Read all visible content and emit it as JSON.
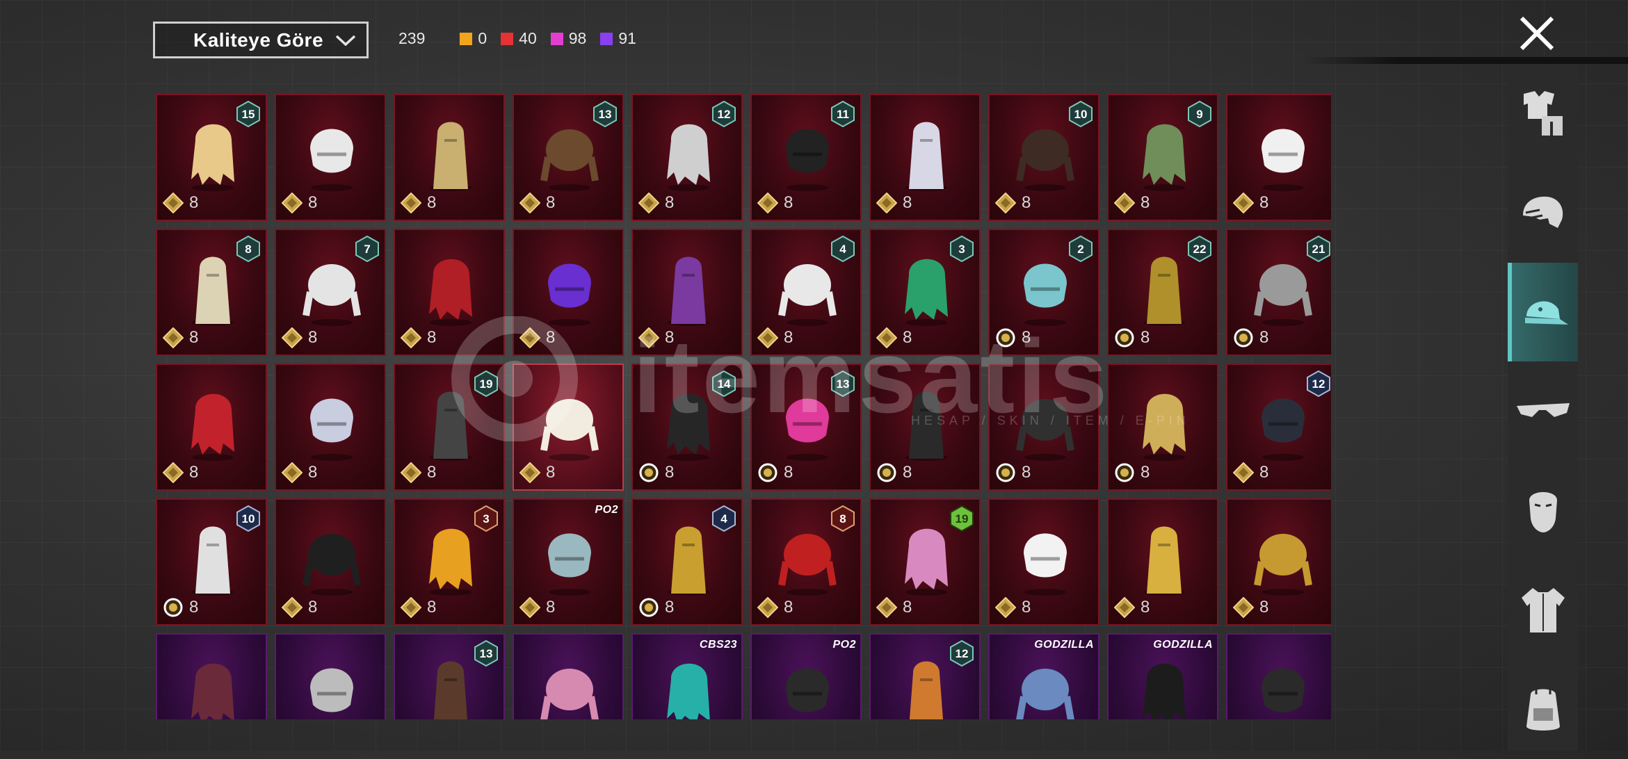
{
  "filter": {
    "label": "Kaliteye Göre"
  },
  "counts": {
    "total": "239",
    "orange": "0",
    "red": "40",
    "magenta": "98",
    "purple": "91",
    "colors": {
      "orange": "#f2a51c",
      "red": "#e63233",
      "magenta": "#e23fd0",
      "purple": "#8b3ff0"
    }
  },
  "watermark": {
    "text": "itemsatis",
    "sub": "HESAP / SKIN / ITEM / E-PIN"
  },
  "sidebar": [
    {
      "name": "outfit",
      "icon": "outfit-icon"
    },
    {
      "name": "hair",
      "icon": "hair-icon"
    },
    {
      "name": "headwear",
      "icon": "cap-icon",
      "active": true
    },
    {
      "name": "eyewear",
      "icon": "glasses-icon"
    },
    {
      "name": "face",
      "icon": "face-icon"
    },
    {
      "name": "top",
      "icon": "shirt-icon"
    },
    {
      "name": "backpack",
      "icon": "backpack-icon"
    }
  ],
  "items": [
    {
      "name": "blonde-hair-with-blue-bow",
      "badge": "15",
      "badge_style": "teal",
      "count": "8",
      "currency": "gold",
      "color": "#e8c98a"
    },
    {
      "name": "white-hair-with-horns",
      "badge": "",
      "count": "8",
      "currency": "gold",
      "color": "#e8e8e8"
    },
    {
      "name": "blonde-hair-with-gold-mask",
      "badge": "",
      "count": "8",
      "currency": "gold",
      "color": "#c9b070"
    },
    {
      "name": "witch-hat-brown-hair",
      "badge": "13",
      "badge_style": "teal",
      "count": "8",
      "currency": "gold",
      "color": "#6b4a2e"
    },
    {
      "name": "grey-curly-hair",
      "badge": "12",
      "badge_style": "teal",
      "count": "8",
      "currency": "gold",
      "color": "#cfcfcf"
    },
    {
      "name": "black-sleek-hair",
      "badge": "11",
      "badge_style": "teal",
      "count": "8",
      "currency": "gold",
      "color": "#222222"
    },
    {
      "name": "silver-hair-purple-horns",
      "badge": "",
      "count": "8",
      "currency": "gold",
      "color": "#d7d7e6"
    },
    {
      "name": "dark-braided-hair",
      "badge": "10",
      "badge_style": "teal",
      "count": "8",
      "currency": "gold",
      "color": "#3e2b23"
    },
    {
      "name": "zombie-head-mohawk",
      "badge": "9",
      "badge_style": "teal",
      "count": "8",
      "currency": "gold",
      "color": "#6f8e5a"
    },
    {
      "name": "white-cowboy-hat",
      "badge": "",
      "count": "8",
      "currency": "gold",
      "color": "#f0f0f0"
    },
    {
      "name": "blonde-bob-feather",
      "badge": "8",
      "badge_style": "teal",
      "count": "8",
      "currency": "gold",
      "color": "#dcd2b4"
    },
    {
      "name": "long-white-ponytail",
      "badge": "7",
      "badge_style": "teal",
      "count": "8",
      "currency": "gold",
      "color": "#e4e4e4"
    },
    {
      "name": "red-black-helmet",
      "badge": "",
      "count": "8",
      "currency": "gold",
      "color": "#b01e26"
    },
    {
      "name": "purple-bunny-twintails",
      "badge": "",
      "count": "8",
      "currency": "gold",
      "color": "#6a2fd0"
    },
    {
      "name": "purple-cat-ears-pigtails",
      "badge": "",
      "count": "8",
      "currency": "gold",
      "color": "#7a3aa0"
    },
    {
      "name": "snowman-top-hat",
      "badge": "4",
      "badge_style": "teal",
      "count": "8",
      "currency": "gold",
      "color": "#e8e8e8"
    },
    {
      "name": "green-curly-joker-mask",
      "badge": "3",
      "badge_style": "teal",
      "count": "8",
      "currency": "gold",
      "color": "#2aa06a"
    },
    {
      "name": "teal-bucket-hat",
      "badge": "2",
      "badge_style": "teal",
      "count": "8",
      "currency": "silver",
      "color": "#7ac6cc"
    },
    {
      "name": "golden-pharaoh-headdress",
      "badge": "22",
      "badge_style": "teal",
      "count": "8",
      "currency": "silver",
      "color": "#b0902a"
    },
    {
      "name": "oni-white-hair-mask",
      "badge": "21",
      "badge_style": "teal",
      "count": "8",
      "currency": "silver",
      "color": "#9a9a9a"
    },
    {
      "name": "red-demon-helmet",
      "badge": "",
      "count": "8",
      "currency": "gold",
      "color": "#c2222c"
    },
    {
      "name": "silver-long-ponytail",
      "badge": "",
      "count": "8",
      "currency": "gold",
      "color": "#c8cde0"
    },
    {
      "name": "dark-tactical-helmet",
      "badge": "19",
      "badge_style": "teal",
      "count": "8",
      "currency": "gold",
      "color": "#444444"
    },
    {
      "name": "white-veil-hood",
      "badge": "",
      "count": "8",
      "currency": "gold",
      "color": "#f2ece0",
      "selected": true
    },
    {
      "name": "black-gold-crown-hood",
      "badge": "14",
      "badge_style": "teal",
      "count": "8",
      "currency": "silver",
      "color": "#262626"
    },
    {
      "name": "pink-dreadlock-mask",
      "badge": "13",
      "badge_style": "teal",
      "count": "8",
      "currency": "silver",
      "color": "#e03a9a"
    },
    {
      "name": "black-cat-ear-hood",
      "badge": "",
      "count": "8",
      "currency": "silver",
      "color": "#2a2a2a"
    },
    {
      "name": "black-wolf-hood",
      "badge": "",
      "count": "8",
      "currency": "silver",
      "color": "#303030"
    },
    {
      "name": "gold-anubis-helmet",
      "badge": "",
      "count": "8",
      "currency": "silver",
      "color": "#cfae5a"
    },
    {
      "name": "dark-gold-visor-helmet",
      "badge": "12",
      "badge_style": "navy",
      "count": "8",
      "currency": "gold",
      "color": "#2a2e3a"
    },
    {
      "name": "white-bird-mask",
      "badge": "10",
      "badge_style": "navy",
      "count": "8",
      "currency": "silver",
      "color": "#e0e0e0"
    },
    {
      "name": "black-horned-helmet",
      "badge": "",
      "count": "8",
      "currency": "gold",
      "color": "#1f1f1f"
    },
    {
      "name": "french-fries-hat",
      "badge": "3",
      "badge_style": "red",
      "count": "8",
      "currency": "gold",
      "color": "#e8a020"
    },
    {
      "name": "cyber-cat-helmet",
      "badge": "PO2",
      "badge_style": "tag",
      "count": "8",
      "currency": "gold",
      "color": "#9ab8c0"
    },
    {
      "name": "gold-knight-helmet",
      "badge": "4",
      "badge_style": "navy",
      "count": "8",
      "currency": "silver",
      "color": "#c9a030"
    },
    {
      "name": "red-straw-hat",
      "badge": "8",
      "badge_style": "red",
      "count": "8",
      "currency": "gold",
      "color": "#c02020"
    },
    {
      "name": "pink-horned-mask",
      "badge": "19",
      "badge_style": "lime",
      "count": "8",
      "currency": "gold",
      "color": "#d88ac0"
    },
    {
      "name": "white-ghost-hood",
      "badge": "",
      "count": "8",
      "currency": "gold",
      "color": "#f2f2f2"
    },
    {
      "name": "gold-anubis-mask",
      "badge": "",
      "count": "8",
      "currency": "gold",
      "color": "#d8b040"
    },
    {
      "name": "gold-anubis-mask-dark",
      "badge": "",
      "count": "8",
      "currency": "gold",
      "color": "#c69a30"
    },
    {
      "name": "maroon-long-hair",
      "badge": "",
      "count": "",
      "purple": true,
      "color": "#6a2a3a"
    },
    {
      "name": "grey-hair-red-glasses",
      "badge": "",
      "count": "",
      "purple": true,
      "color": "#bcbcbc"
    },
    {
      "name": "aviator-cap",
      "badge": "13",
      "badge_style": "teal",
      "count": "",
      "purple": true,
      "color": "#5a3a2a"
    },
    {
      "name": "pink-pigtails",
      "badge": "",
      "count": "",
      "purple": true,
      "color": "#d68ab0"
    },
    {
      "name": "cat-ear-headphones",
      "badge": "CBS23",
      "badge_style": "hex",
      "count": "",
      "purple": true,
      "color": "#27b0a8"
    },
    {
      "name": "black-cap-red-visor",
      "badge": "PO2",
      "badge_style": "tag",
      "count": "",
      "purple": true,
      "color": "#2a2a2a"
    },
    {
      "name": "orange-twin-buns",
      "badge": "12",
      "badge_style": "teal",
      "count": "",
      "purple": true,
      "color": "#d07a30"
    },
    {
      "name": "blue-shaggy-hair",
      "badge": "GODZILLA",
      "badge_style": "tag",
      "count": "",
      "purple": true,
      "color": "#6a8ac0"
    },
    {
      "name": "black-spiky-hair-goggles",
      "badge": "GODZILLA",
      "badge_style": "tag",
      "count": "",
      "purple": true,
      "color": "#1c1c1c"
    },
    {
      "name": "dark-short-hair",
      "badge": "",
      "count": "",
      "purple": true,
      "color": "#2a2a2a"
    }
  ]
}
